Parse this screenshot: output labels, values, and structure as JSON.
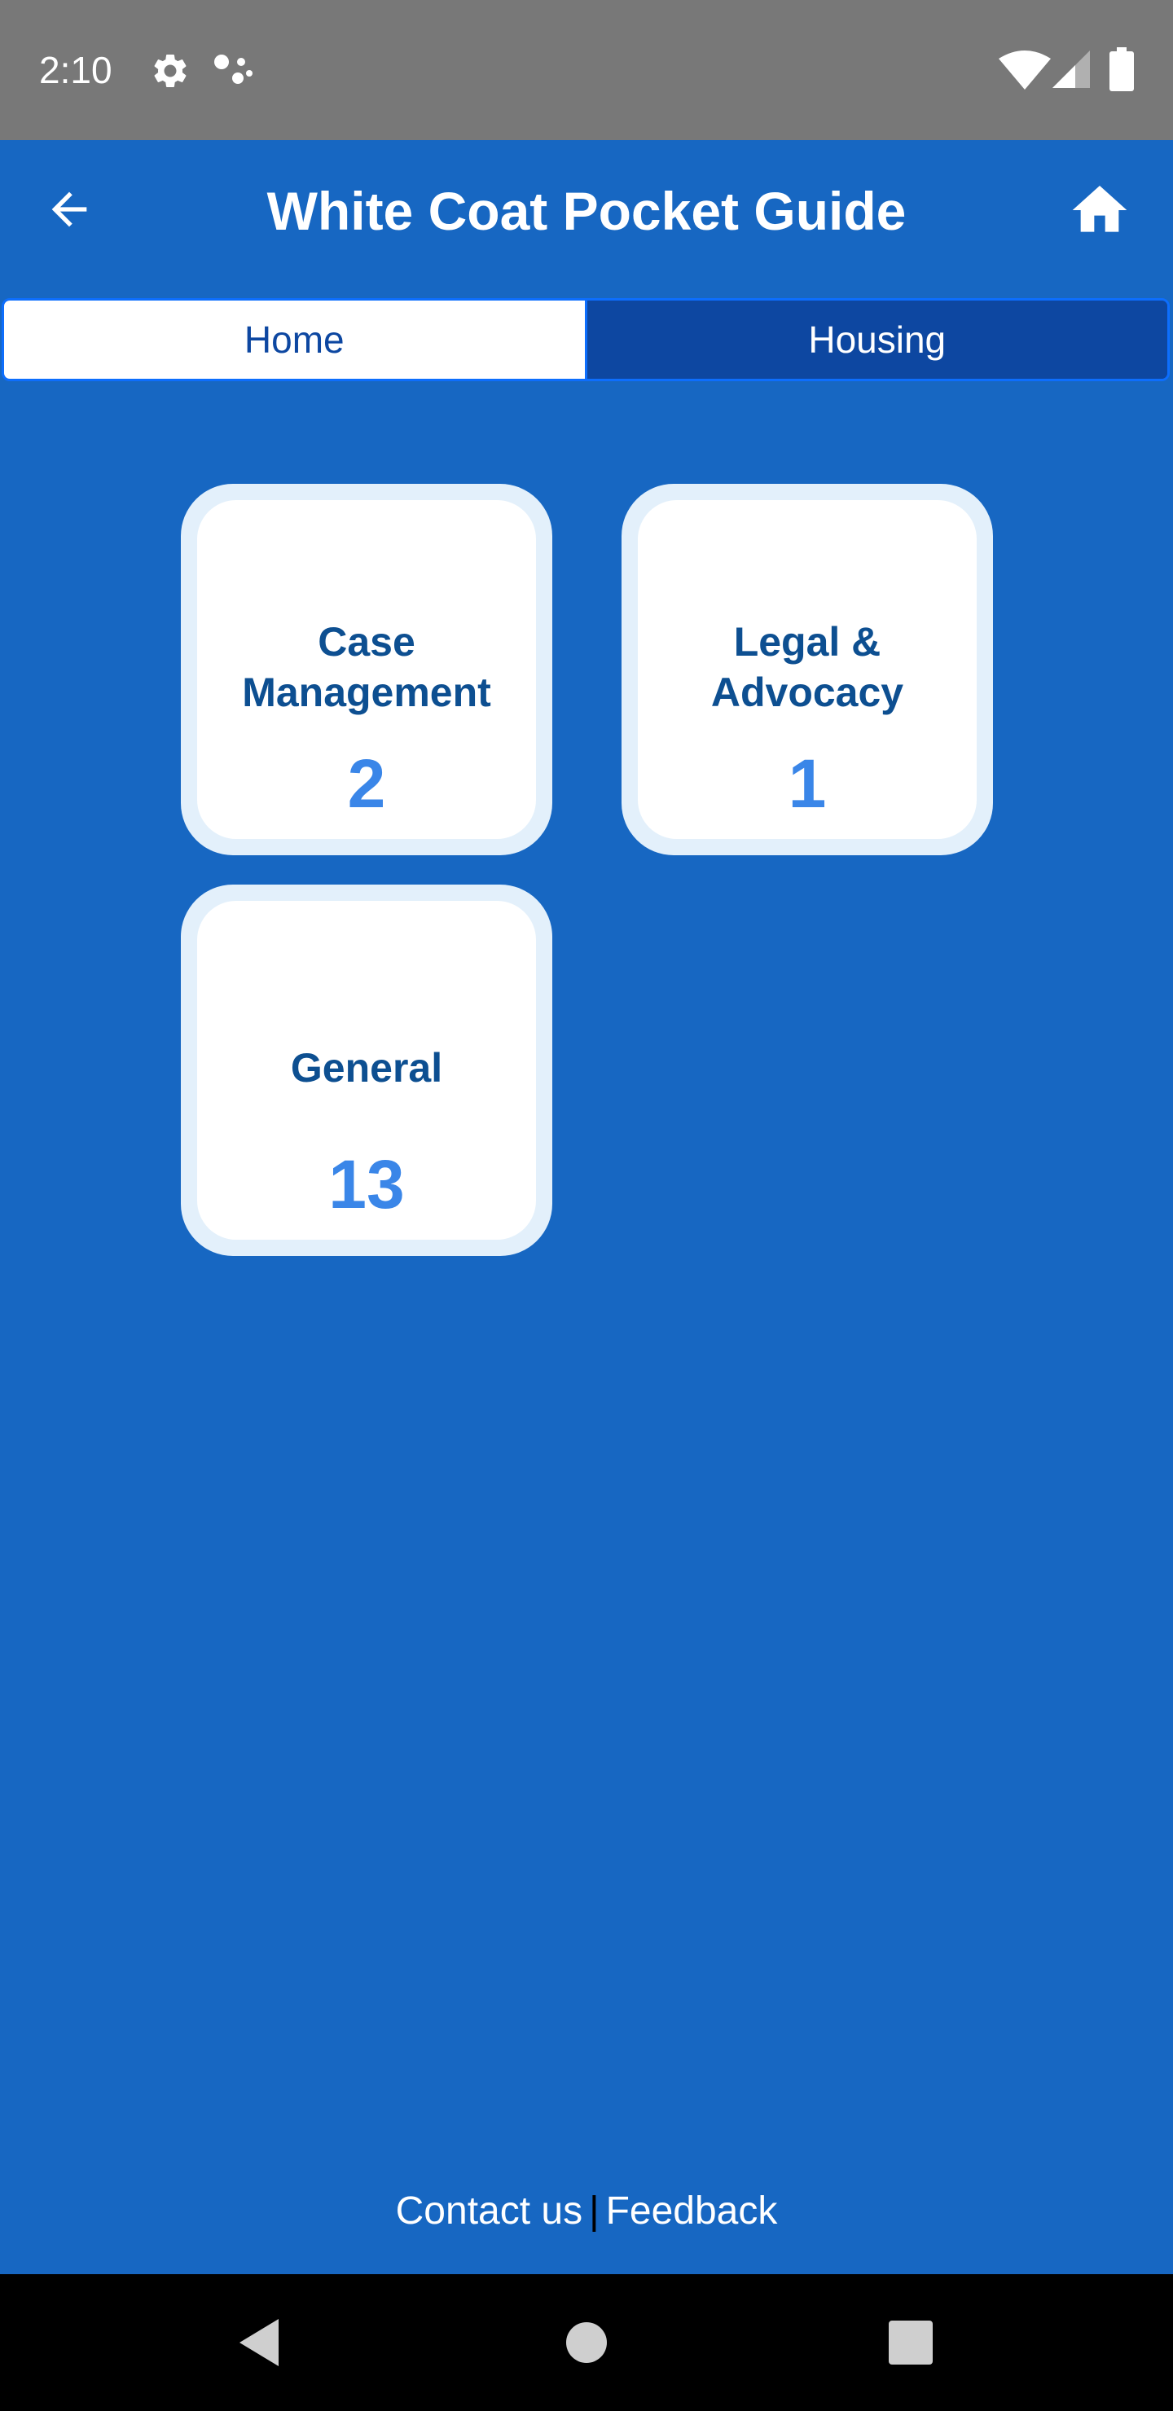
{
  "status_bar": {
    "time": "2:10",
    "icons": [
      "gear-icon",
      "assistant-dots-icon",
      "wifi-icon",
      "cellular-signal-icon",
      "battery-icon"
    ]
  },
  "app_bar": {
    "title": "White Coat Pocket Guide",
    "back_icon": "arrow-left-icon",
    "home_icon": "home-icon"
  },
  "tabs": [
    {
      "label": "Home",
      "active": true
    },
    {
      "label": "Housing",
      "active": false
    }
  ],
  "cards": [
    {
      "label": "Case Management",
      "count": "2"
    },
    {
      "label": "Legal & Advocacy",
      "count": "1"
    },
    {
      "label": "General",
      "count": "13"
    }
  ],
  "footer": {
    "contact": "Contact us",
    "separator": "|",
    "feedback": "Feedback"
  },
  "nav_bar": {
    "icons": [
      "back-triangle-icon",
      "home-circle-icon",
      "recents-square-icon"
    ]
  },
  "colors": {
    "background": "#1767c2",
    "status_bar": "#787878",
    "tab_active_bg": "#ffffff",
    "tab_inactive_bg": "#0d47a1",
    "card_label": "#0d4f91",
    "card_count": "#3a86e8"
  }
}
